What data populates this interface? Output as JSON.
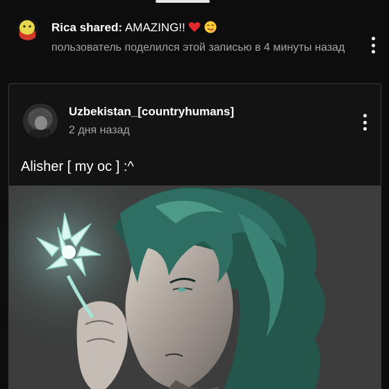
{
  "share": {
    "author": "Rica shared:",
    "message": "AMAZING!!",
    "emojis": [
      "red-heart",
      "savoring-face"
    ],
    "subtitle": "пользователь поделился этой записью в 4 минуты назад"
  },
  "post": {
    "author": "Uzbekistan_[countryhumans]",
    "time": "2 дня назад",
    "text": "Alisher [ my oc ] :^",
    "image_subject": "drawing of a character with teal hair holding a glowing crystal flower"
  },
  "colors": {
    "background": "#0d0d0d",
    "card_border": "#3a3a3a",
    "secondary_text": "#a5a5a5",
    "hair": "#2f6e62",
    "glow": "#bfeee4"
  },
  "icons": [
    "more-vertical-icon",
    "more-vertical-icon"
  ]
}
